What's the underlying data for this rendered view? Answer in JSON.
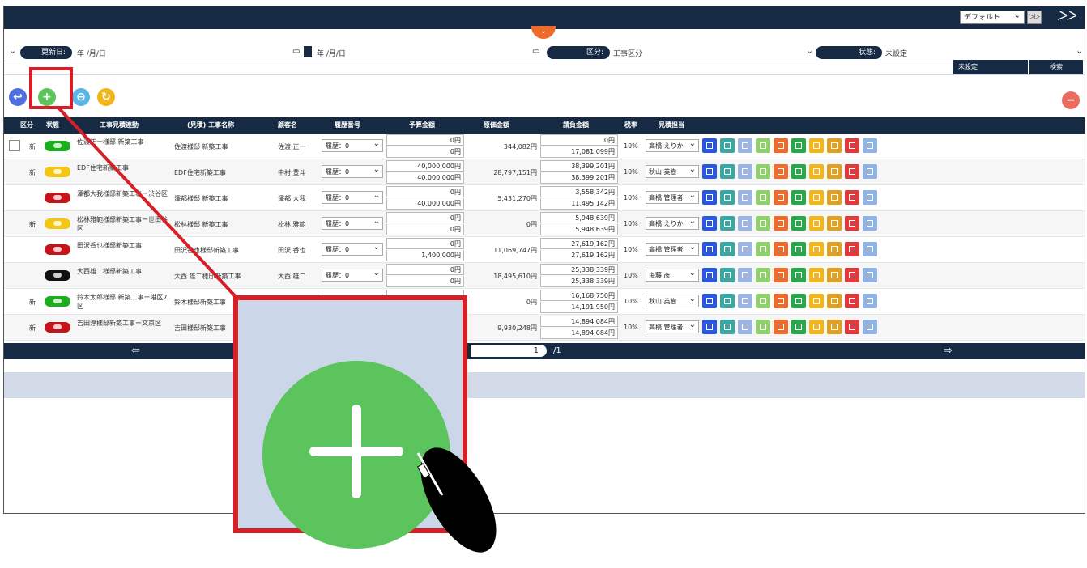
{
  "topbar": {
    "profile_select": "デフォルト",
    "apply_label": "▷▷",
    "logo": "ᐳᐳ"
  },
  "toggle_label": "⌄",
  "filters": {
    "updated_label": "更新日",
    "date_placeholder": "年 /月/日",
    "category_label": "区分",
    "category_value": "工事区分",
    "state_label": "状態",
    "state_value": "未設定",
    "status_select": "未設定",
    "search_button": "検索"
  },
  "table": {
    "headers": [
      "区分",
      "状態",
      "工事見積連動",
      "(見積) 工事名称",
      "顧客名",
      "履歴番号",
      "予算金額",
      "原価金額",
      "請負金額",
      "税率",
      "見積担当"
    ],
    "history_value": "履歴：0",
    "rows": [
      {
        "kubun": "新",
        "status": "green",
        "title": "佐渡正一様邸 新築工事",
        "name": "佐渡様邸 新築工事",
        "customer": "佐渡 正一",
        "budget": [
          "0円",
          "0円"
        ],
        "cost": "344,082円",
        "contract": [
          "0円",
          "17,081,099円"
        ],
        "tax": "10%",
        "owner": "高橋 えりか",
        "checkbox": true
      },
      {
        "kubun": "新",
        "status": "yellow",
        "title": "EDF住宅新築工事",
        "name": "EDF住宅新築工事",
        "customer": "中村 豊斗",
        "budget": [
          "40,000,000円",
          "40,000,000円"
        ],
        "cost": "28,797,151円",
        "contract": [
          "38,399,201円",
          "38,399,201円"
        ],
        "tax": "10%",
        "owner": "秋山 英樹"
      },
      {
        "kubun": "",
        "status": "red",
        "title": "澤都大我様邸新築工事ー渋谷区",
        "name": "澤都様邸 新築工事",
        "customer": "澤都 大我",
        "budget": [
          "0円",
          "40,000,000円"
        ],
        "cost": "5,431,270円",
        "contract": [
          "3,558,342円",
          "11,495,142円"
        ],
        "tax": "10%",
        "owner": "高橋 管理者"
      },
      {
        "kubun": "新",
        "status": "yellow",
        "title": "松林雅範様邸新築工事ー世田谷区",
        "name": "松林様邸 新築工事",
        "customer": "松林 雅範",
        "budget": [
          "0円",
          "0円"
        ],
        "cost": "0円",
        "contract": [
          "5,948,639円",
          "5,948,639円"
        ],
        "tax": "10%",
        "owner": "高橋 えりか"
      },
      {
        "kubun": "",
        "status": "red",
        "title": "田沢香也様邸新築工事",
        "name": "田沢香也様邸新築工事",
        "customer": "田沢 香也",
        "budget": [
          "0円",
          "1,400,000円"
        ],
        "cost": "11,069,747円",
        "contract": [
          "27,619,162円",
          "27,619,162円"
        ],
        "tax": "10%",
        "owner": "高橋 管理者"
      },
      {
        "kubun": "",
        "status": "black",
        "title": "大西雄二様邸新築工事",
        "name": "大西 雄二様邸新築工事",
        "customer": "大西 雄二",
        "budget": [
          "0円",
          "0円"
        ],
        "cost": "18,495,610円",
        "contract": [
          "25,338,339円",
          "25,338,339円"
        ],
        "tax": "10%",
        "owner": "海藤 彦"
      },
      {
        "kubun": "新",
        "status": "green",
        "title": "鈴木太郎様邸 新築工事ー港区7区",
        "name": "鈴木様邸新築工事",
        "customer": "",
        "budget": [
          "",
          ""
        ],
        "cost": "0円",
        "contract": [
          "16,168,750円",
          "14,191,950円"
        ],
        "tax": "10%",
        "owner": "秋山 英樹"
      },
      {
        "kubun": "新",
        "status": "red",
        "title": "吉田淳様邸新築工事ー文京区",
        "name": "吉田様邸新築工事",
        "customer": "",
        "budget": [
          "",
          ""
        ],
        "cost": "9,930,248円",
        "contract": [
          "14,894,084円",
          "14,894,084円"
        ],
        "tax": "10%",
        "owner": "高橋 管理者"
      }
    ]
  },
  "pager": {
    "prev": "⇦",
    "next": "⇨",
    "page": "1",
    "total": "/1"
  },
  "colors": {
    "navy": "#172a44",
    "accent_red": "#d61f26",
    "add_green": "#5cc45c",
    "orange": "#f06a2c"
  },
  "icons": {
    "back": "↩",
    "add": "+",
    "copy": "⊖",
    "refresh": "↻",
    "remove": "−"
  }
}
